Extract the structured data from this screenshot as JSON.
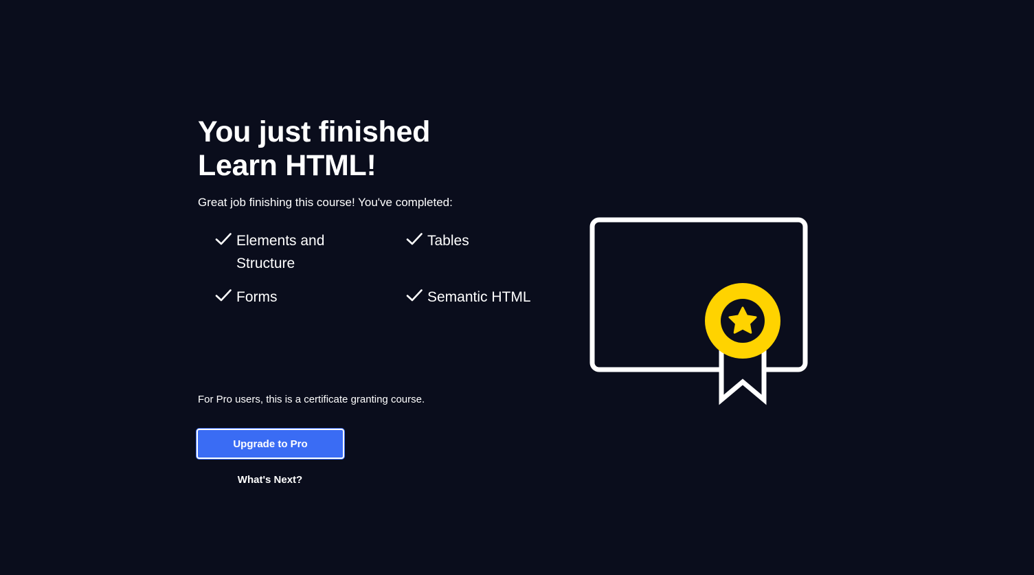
{
  "heading": {
    "line1": "You just finished",
    "line2": "Learn HTML!"
  },
  "intro": "Great job finishing this course! You've completed:",
  "completed_items": [
    {
      "label": "Elements and Structure"
    },
    {
      "label": "Tables"
    },
    {
      "label": "Forms"
    },
    {
      "label": "Semantic HTML"
    }
  ],
  "pro_note": "For Pro users, this is a certificate granting course.",
  "upgrade_button": "Upgrade to Pro",
  "whats_next_link": "What's Next?",
  "icons": {
    "check": "check-icon",
    "certificate": "certificate-icon",
    "badge": "star-badge-icon"
  },
  "colors": {
    "background": "#0a0d1c",
    "text": "#ffffff",
    "primary_button": "#3a6cf4",
    "badge": "#ffd300"
  }
}
